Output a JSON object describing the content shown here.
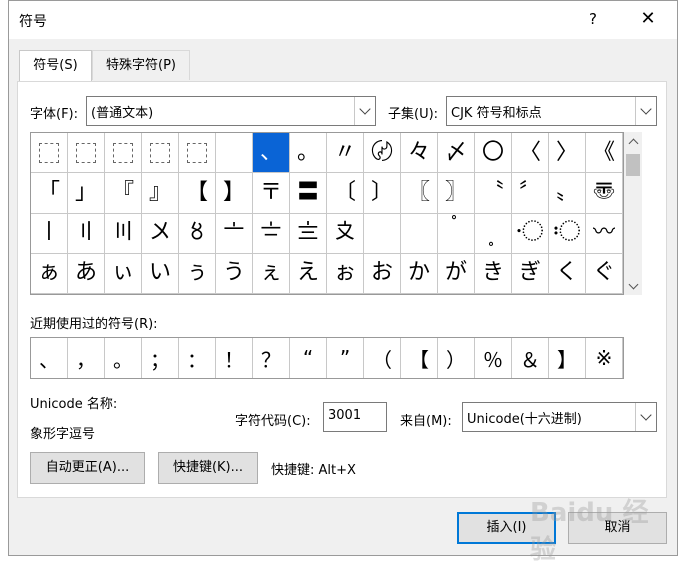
{
  "window": {
    "title": "符号",
    "help_label": "?",
    "close_label": "✕"
  },
  "tabs": [
    {
      "label": "符号(S)"
    },
    {
      "label": "特殊字符(P)"
    }
  ],
  "font": {
    "label": "字体(F):",
    "value": "(普通文本)"
  },
  "subset": {
    "label": "子集(U):",
    "value": "CJK 符号和标点"
  },
  "symbol_grid": [
    [
      "⿰",
      "⿱",
      "⿲",
      "⿳",
      "⿴",
      "",
      "、",
      "。",
      "〃",
      "〄",
      "々",
      "〆",
      "〇",
      "〈",
      "〉",
      "《"
    ],
    [
      "「",
      "」",
      "『",
      "』",
      "【",
      "】",
      "〒",
      "〓",
      "〔",
      "〕",
      "〖",
      "〗",
      "〝",
      "〞",
      "〟",
      "〠"
    ],
    [
      "〡",
      "〢",
      "〣",
      "〤",
      "〥",
      "〦",
      "〧",
      "〨",
      "〩",
      "〪",
      "〫",
      "〬",
      "〭",
      "〮",
      "〯",
      "〰"
    ],
    [
      "ぁ",
      "あ",
      "ぃ",
      "い",
      "ぅ",
      "う",
      "ぇ",
      "え",
      "ぉ",
      "お",
      "か",
      "が",
      "き",
      "ぎ",
      "く",
      "ぐ"
    ]
  ],
  "recent": {
    "label": "近期使用过的符号(R):",
    "symbols": [
      "、",
      "，",
      "。",
      "；",
      "：",
      "！",
      "？",
      "“",
      "”",
      "（",
      "【",
      "）",
      "％",
      "＆",
      "】",
      "※"
    ]
  },
  "unicode": {
    "name_label": "Unicode 名称:",
    "name_value": "象形字逗号"
  },
  "char_code": {
    "label": "字符代码(C):",
    "value": "3001"
  },
  "from": {
    "label": "来自(M):",
    "value": "Unicode(十六进制)"
  },
  "buttons": {
    "autocorrect": "自动更正(A)...",
    "shortcut": "快捷键(K)...",
    "insert": "插入(I)",
    "cancel": "取消"
  },
  "shortcut_text": "快捷键: Alt+X",
  "watermark": "Baidu 经验",
  "colors": {
    "selection": "#0a64d6",
    "primary_border": "#0078d7"
  }
}
